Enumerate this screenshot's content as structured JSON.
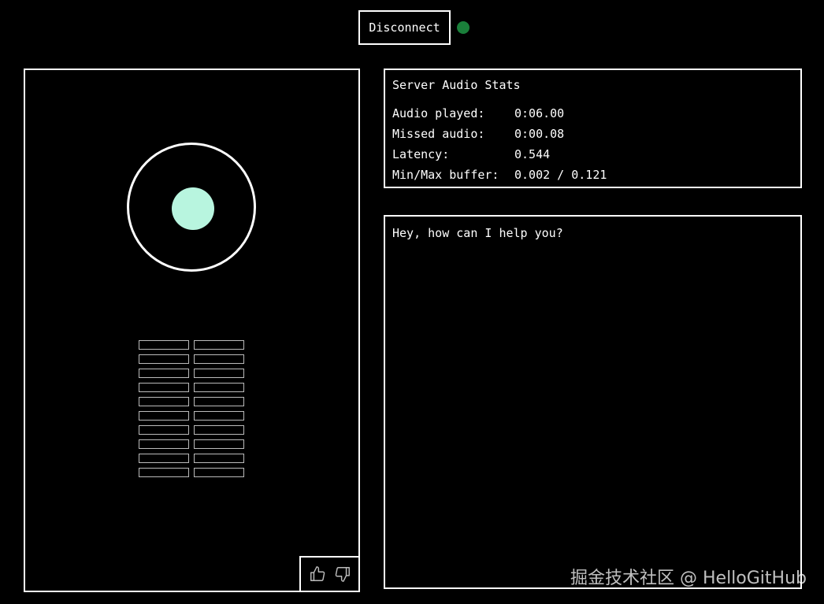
{
  "header": {
    "disconnect_label": "Disconnect",
    "connection_status_color": "#1a7f3a"
  },
  "visualizer": {
    "core_color": "#b8f5df",
    "meter_rows": 10,
    "meter_columns": 2
  },
  "feedback": {
    "thumbs_up_icon": "thumbs-up-icon",
    "thumbs_down_icon": "thumbs-down-icon"
  },
  "stats": {
    "title": "Server Audio Stats",
    "rows": [
      {
        "label": "Audio played:",
        "value": "0:06.00"
      },
      {
        "label": "Missed audio:",
        "value": "0:00.08"
      },
      {
        "label": "Latency:",
        "value": "0.544"
      },
      {
        "label": "Min/Max buffer:",
        "value": "0.002 / 0.121"
      }
    ]
  },
  "chat": {
    "message": "Hey, how can I help you?"
  },
  "watermark": "掘金技术社区 @ HelloGitHub"
}
